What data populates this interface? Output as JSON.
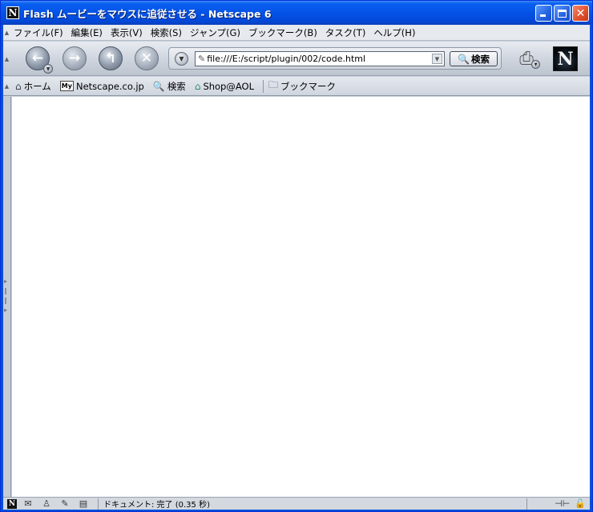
{
  "window": {
    "title": "Flash ムービーをマウスに追従させる - Netscape 6",
    "app_icon_letter": "N"
  },
  "menubar": {
    "items": [
      {
        "label": "ファイル(F)"
      },
      {
        "label": "編集(E)"
      },
      {
        "label": "表示(V)"
      },
      {
        "label": "検索(S)"
      },
      {
        "label": "ジャンプ(G)"
      },
      {
        "label": "ブックマーク(B)"
      },
      {
        "label": "タスク(T)"
      },
      {
        "label": "ヘルプ(H)"
      }
    ]
  },
  "navbar": {
    "back_icon": "back-arrow-icon",
    "forward_icon": "forward-arrow-icon",
    "reload_icon": "reload-icon",
    "stop_icon": "stop-icon",
    "url": "file:///E:/script/plugin/002/code.html",
    "search_label": "検索",
    "logo_letter": "N"
  },
  "personal_toolbar": {
    "home": "ホーム",
    "my_badge": "My",
    "netscape": "Netscape.co.jp",
    "search": "検索",
    "shop": "Shop@AOL",
    "bookmarks": "ブックマーク"
  },
  "statusbar": {
    "status_text": "ドキュメント: 完了 (0.35 秒)",
    "logo_letter": "N"
  },
  "colors": {
    "titlebar": "#0453e6",
    "chrome": "#d0d6df",
    "content": "#ffffff"
  }
}
